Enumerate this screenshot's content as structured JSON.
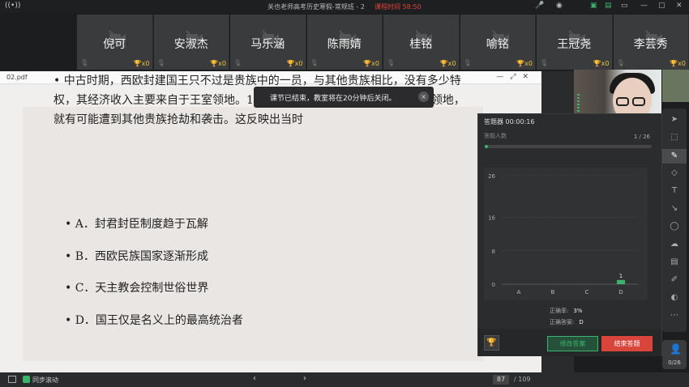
{
  "titlebar": {
    "title": "关也老师高考历史寒假-常规班 - 2",
    "timer": "课程时间 58:50",
    "icons": [
      "signal-icon",
      "mic-icon",
      "speaker-icon",
      "camera-icon",
      "settings-icon",
      "minimize-icon",
      "restore-icon",
      "close-icon"
    ]
  },
  "students": [
    {
      "name": "倪可",
      "trophies": "x0"
    },
    {
      "name": "安淑杰",
      "trophies": "x0"
    },
    {
      "name": "马乐涵",
      "trophies": "x0"
    },
    {
      "name": "陈雨婧",
      "trophies": "x0"
    },
    {
      "name": "桂铭",
      "trophies": "x0"
    },
    {
      "name": "喻铭",
      "trophies": "x0"
    },
    {
      "name": "王冠尧",
      "trophies": "x0"
    },
    {
      "name": "李芸秀",
      "trophies": "x0"
    }
  ],
  "pdf": {
    "filename": "02.pdf",
    "question": "• 中古时期，西欧封建国王只不过是贵族中的一员，与其他贵族相比，没有多少特权，其经济收入主要来自于王室领地。10世纪时的法国国王如果离开自己的领地，就有可能遭到其他贵族抢劫和袭击。这反映出当时",
    "options": [
      "• A．封君封臣制度趋于瓦解",
      "• B．西欧民族国家逐渐形成",
      "• C．天主教会控制世俗世界",
      "• D．国王仅是名义上的最高统治者"
    ]
  },
  "toast": {
    "text": "课节已结束，教室将在20分钟后关闭。",
    "close": "×"
  },
  "video": {
    "label": "关也"
  },
  "quiz": {
    "title": "答题器  00:00:16",
    "count_label": "答题人数",
    "count_value": "1 / 26",
    "correct_rate_label": "正确率:",
    "correct_rate": "3%",
    "correct_answer_label": "正确答案:",
    "correct_answer": "D",
    "edit_button": "修改答案",
    "end_button": "结束答题"
  },
  "chart_data": {
    "type": "bar",
    "categories": [
      "A",
      "B",
      "C",
      "D"
    ],
    "values": [
      0,
      0,
      0,
      1
    ],
    "yticks": [
      0,
      8,
      16,
      26
    ],
    "ylim": [
      0,
      26
    ],
    "data_labels": [
      "",
      "",
      "",
      "1"
    ],
    "bar_color": "#3bb36a"
  },
  "bottombar": {
    "sync_label": "同步滚动",
    "page_current": "87",
    "page_total": "/ 109"
  },
  "roster": {
    "count": "0/26"
  },
  "tools": [
    "pointer-icon",
    "select-icon",
    "pen-icon",
    "eraser-icon",
    "text-icon",
    "shape-icon",
    "laser-icon",
    "cloud-icon",
    "toolbox-icon",
    "edit-icon",
    "chat-icon",
    "more-icon"
  ]
}
